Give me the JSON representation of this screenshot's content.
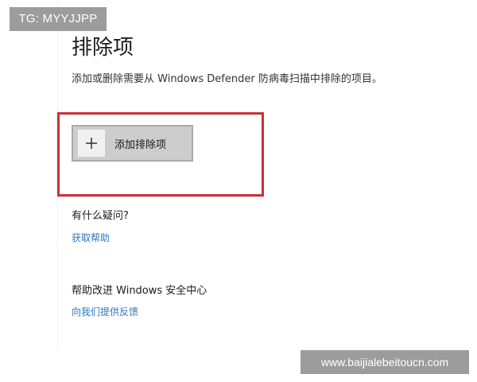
{
  "watermarks": {
    "top_left": "TG: MYYJJPP",
    "bottom_right": "www.baijialebeitoucn.com"
  },
  "page": {
    "title": "排除项",
    "description": "添加或删除需要从 Windows Defender 防病毒扫描中排除的项目。"
  },
  "add_exclusion": {
    "icon": "plus-icon",
    "label": "添加排除项"
  },
  "help": {
    "heading": "有什么疑问?",
    "link": "获取帮助"
  },
  "improve": {
    "heading": "帮助改进 Windows 安全中心",
    "link": "向我们提供反馈"
  },
  "colors": {
    "highlight": "#c8323a",
    "link": "#2b78c4",
    "button_bg": "#cdcdcd"
  }
}
